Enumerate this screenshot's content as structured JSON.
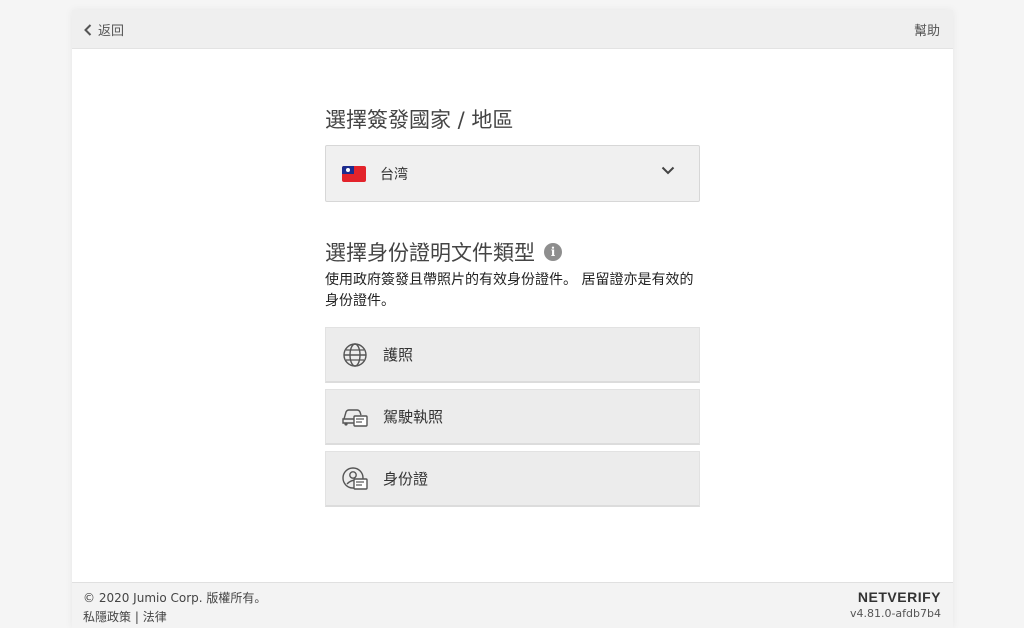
{
  "topbar": {
    "back_label": "返回",
    "help_label": "幫助"
  },
  "country": {
    "heading": "選擇簽發國家 / 地區",
    "selected": "台湾"
  },
  "document": {
    "heading": "選擇身份證明文件類型",
    "info_glyph": "i",
    "description": "使用政府簽發且帶照片的有效身份證件。 居留證亦是有效的身份證件。",
    "options": [
      {
        "label": "護照",
        "icon": "globe-icon"
      },
      {
        "label": "駕駛執照",
        "icon": "car-card-icon"
      },
      {
        "label": "身份證",
        "icon": "person-card-icon"
      }
    ]
  },
  "footer": {
    "copyright": "© 2020 Jumio Corp. 版權所有。",
    "privacy_label": "私隱政策",
    "separator": "|",
    "legal_label": "法律",
    "brand": "NETVERIFY",
    "version": "v4.81.0-afdb7b4"
  },
  "colors": {
    "page_bg": "#f5f5f5",
    "card_bg": "#ffffff",
    "option_bg": "#ececec",
    "flag_red": "#e3232b",
    "flag_blue": "#1b2c8f"
  }
}
